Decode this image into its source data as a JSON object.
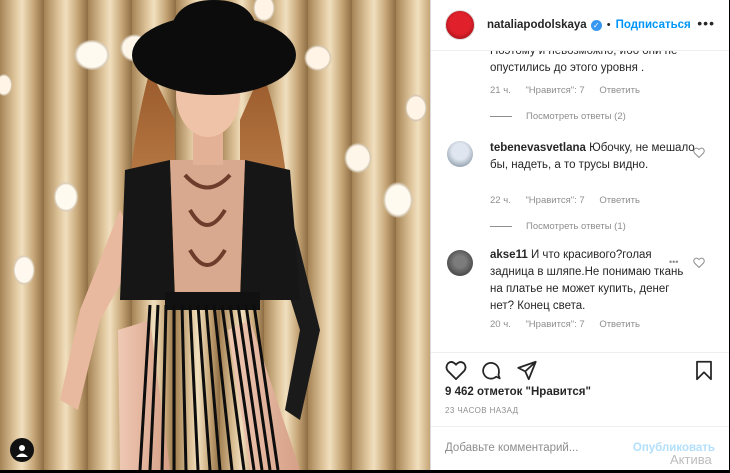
{
  "post": {
    "username": "nataliapodolskaya",
    "verified_icon": "verified-badge-icon",
    "dot": "•",
    "follow_label": "Подписаться",
    "more_icon": "more-options-icon",
    "more_label": "•••"
  },
  "comments": [
    {
      "username": "",
      "text": "Поэтому и невозможно, ибо они не опустились до этого уровня .",
      "time": "21 ч.",
      "likes": "\"Нравится\": 7",
      "reply": "Ответить",
      "view_replies": "Посмотреть ответы (2)"
    },
    {
      "username": "tebenevasvetlana",
      "text": "Юбочку, не мешало бы, надеть, а то трусы видно.",
      "time": "22 ч.",
      "likes": "\"Нравится\": 7",
      "reply": "Ответить",
      "view_replies": "Посмотреть ответы (1)"
    },
    {
      "username": "akse11",
      "text": "И что красивого?голая задница в шляпе.Не понимаю ткань на платье не может купить, денег нет? Конец света.",
      "time": "20 ч.",
      "likes": "\"Нравится\": 7",
      "reply": "Ответить"
    }
  ],
  "likes_count": "9 462 отметок \"Нравится\"",
  "posted_time": "23 ЧАСОВ НАЗАД",
  "add_comment_placeholder": "Добавьте комментарий...",
  "publish_label": "Опубликовать",
  "watermark": "Актива"
}
